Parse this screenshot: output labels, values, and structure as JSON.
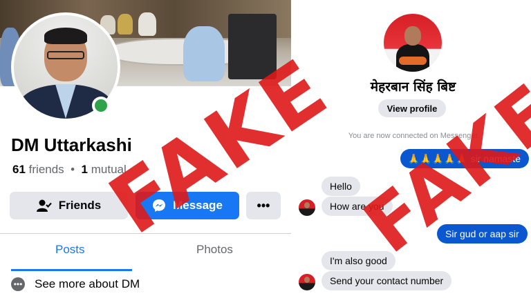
{
  "profile_panel": {
    "name": "DM Uttarkashi",
    "friends_count": "61",
    "friends_label": "friends",
    "separator": "•",
    "mutual_count": "1",
    "mutual_label": "mutual",
    "friends_button_label": "Friends",
    "message_button_label": "Message",
    "more_button_label": "•••",
    "tabs": [
      {
        "label": "Posts",
        "active": true
      },
      {
        "label": "Photos",
        "active": false
      }
    ],
    "see_more_label": "See more about DM",
    "online_status_color": "#31a24c",
    "accent_color": "#1877f2"
  },
  "messenger_panel": {
    "contact_name": "मेहरबान सिंह बिष्ट",
    "view_profile_label": "View profile",
    "connected_notice": "You are now connected on Messenger",
    "messages": [
      {
        "direction": "outgoing",
        "text": "🙏🙏🙏🙏🙏 sir namaste"
      },
      {
        "direction": "incoming",
        "text": "Hello"
      },
      {
        "direction": "incoming",
        "text": "How are you"
      },
      {
        "direction": "outgoing",
        "text": "Sir gud or aap sir"
      },
      {
        "direction": "incoming",
        "text": "I'm also good"
      },
      {
        "direction": "incoming",
        "text": "Send your contact number"
      }
    ],
    "outgoing_bubble_color": "#0a57d0",
    "incoming_bubble_color": "#e4e6eb"
  },
  "stamps": {
    "left_text": "FAKE",
    "right_text": "FAKE",
    "color": "#de1818"
  }
}
